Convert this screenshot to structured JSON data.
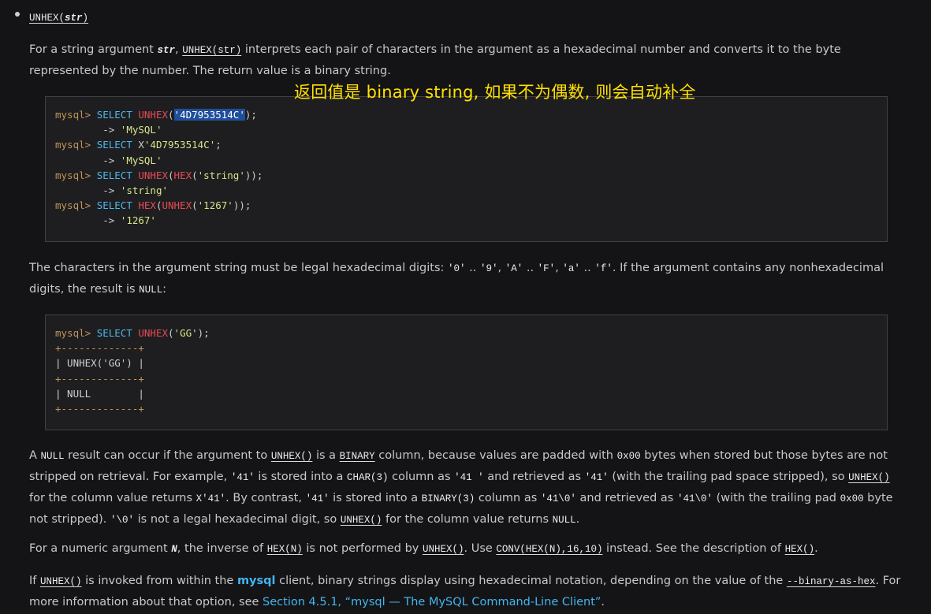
{
  "heading": {
    "func": "UNHEX",
    "arg": "str"
  },
  "p1": {
    "t1": "For a string argument ",
    "arg": "str",
    "t2": ", ",
    "ref": "UNHEX(str)",
    "t3": " interprets each pair of characters in the argument as a hexadecimal number and converts it to the byte represented by the number. The return value is a binary string."
  },
  "annotation": "返回值是 binary string, 如果不为偶数, 则会自动补全",
  "code1": {
    "prompt": "mysql> ",
    "arrow": "        -> ",
    "l1": {
      "kw": "SELECT",
      "fn": "UNHEX",
      "arg": "'4D7953514C'"
    },
    "r1": "'MySQL'",
    "l2": {
      "kw": "SELECT",
      "x": "X",
      "arg": "'4D7953514C'"
    },
    "r2": "'MySQL'",
    "l3": {
      "kw": "SELECT",
      "fn": "UNHEX",
      "fn2": "HEX",
      "arg": "'string'"
    },
    "r3": "'string'",
    "l4": {
      "kw": "SELECT",
      "fn": "HEX",
      "fn2": "UNHEX",
      "arg": "'1267'"
    },
    "r4": "'1267'"
  },
  "p2": {
    "t1": "The characters in the argument string must be legal hexadecimal digits: ",
    "c0": "'0'",
    "dots": " .. ",
    "c9": "'9'",
    "comma": ", ",
    "cA": "'A'",
    "cF": "'F'",
    "ca": "'a'",
    "cf": "'f'",
    "t2": ". If the argument contains any nonhexadecimal digits, the result is ",
    "null": "NULL",
    "t3": ":"
  },
  "code2": {
    "prompt": "mysql> ",
    "kw": "SELECT",
    "fn": "UNHEX",
    "arg": "'GG'",
    "border": "+-------------+",
    "header": "| UNHEX('GG') |",
    "row": "| NULL        |"
  },
  "p3": {
    "a1": "A ",
    "null": "NULL",
    "a2": " result can occur if the argument to ",
    "unhex": "UNHEX()",
    "a3": " is a ",
    "binary": "BINARY",
    "a4": " column, because values are padded with ",
    "x00": "0x00",
    "a5": " bytes when stored but those bytes are not stripped on retrieval. For example, ",
    "v41": "'41'",
    "a6": " is stored into a ",
    "char3": "CHAR(3)",
    "a7": " column as ",
    "v41sp": "'41 '",
    "a8": " and retrieved as ",
    "a9": " (with the trailing pad space stripped), so ",
    "a10": " for the column value returns ",
    "x41": "X'41'",
    "a11": ". By contrast, ",
    "binary3": "BINARY(3)",
    "v410": "'41\\0'",
    "a12": " (with the trailing pad ",
    "a13": " byte not stripped). ",
    "bs0": "'\\0'",
    "a14": " is not a legal hexadecimal digit, so ",
    "a15": " for the column value returns ",
    "a16": "."
  },
  "p4": {
    "t1": "For a numeric argument ",
    "n": "N",
    "t2": ", the inverse of ",
    "hexn": "HEX(N)",
    "t3": " is not performed by ",
    "unhex": "UNHEX()",
    "t4": ". Use ",
    "conv": "CONV(HEX(N),16,10)",
    "t5": " instead. See the description of ",
    "hex": "HEX()",
    "t6": "."
  },
  "p5": {
    "t1": "If ",
    "unhex": "UNHEX()",
    "t2": " is invoked from within the ",
    "mysql": "mysql",
    "t3": " client, binary strings display using hexadecimal notation, depending on the value of the ",
    "opt": "--binary-as-hex",
    "t4": ". For more information about that option, see ",
    "link": "Section 4.5.1, “mysql — The MySQL Command-Line Client”",
    "t5": "."
  }
}
